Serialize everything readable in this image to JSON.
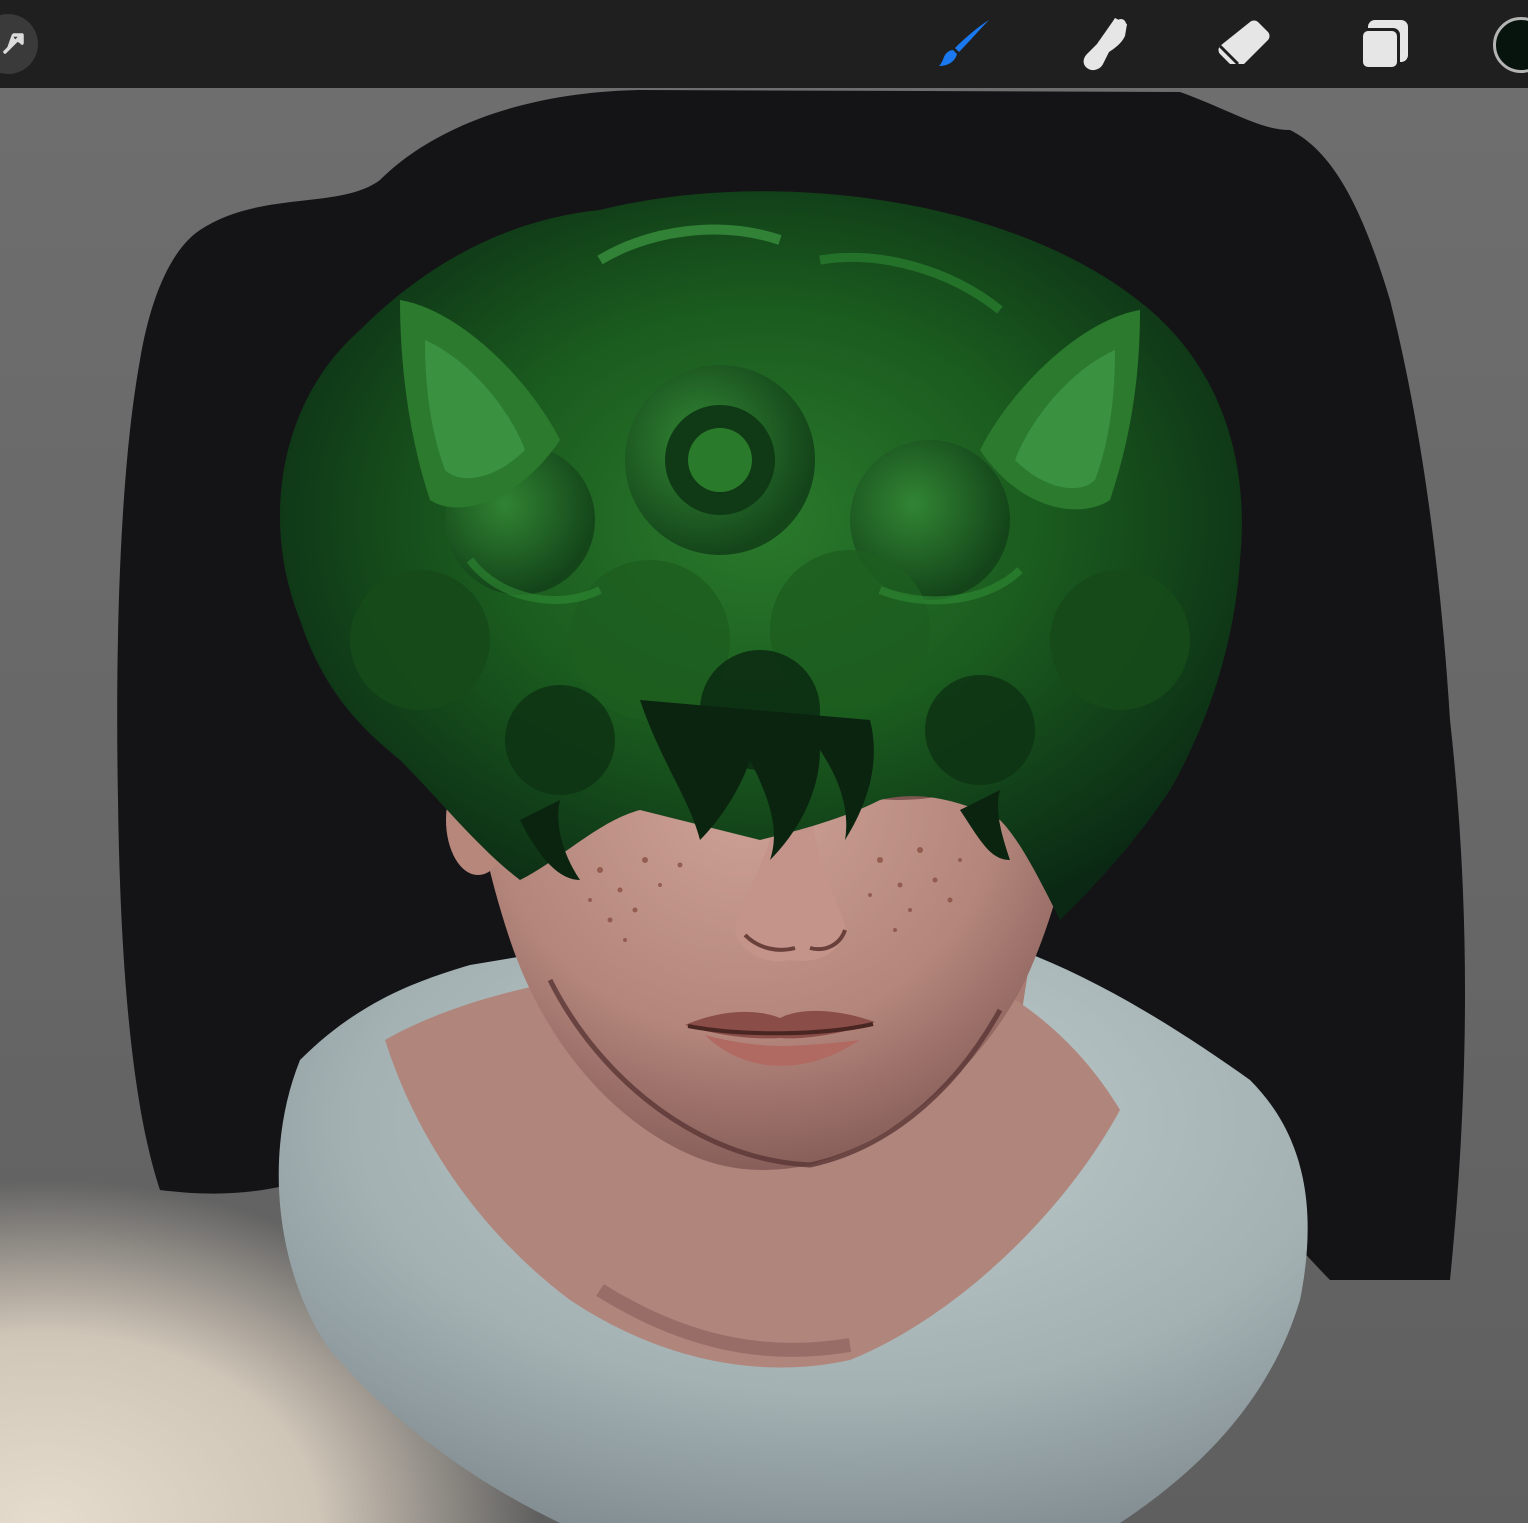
{
  "toolbar": {
    "tools": [
      {
        "id": "transform",
        "icon": "transform-arrow-icon"
      },
      {
        "id": "brush",
        "icon": "brush-icon",
        "active": true
      },
      {
        "id": "smudge",
        "icon": "smudge-icon"
      },
      {
        "id": "eraser",
        "icon": "eraser-icon"
      },
      {
        "id": "layers",
        "icon": "layers-icon"
      }
    ],
    "current_color": "#07140e",
    "active_color": "#1a78f0",
    "icon_color": "#e6e6e6"
  },
  "canvas": {
    "background_color": "#6a6a6a",
    "subject": {
      "hair_color": "#1f5a22",
      "skin_color": "#b98a80",
      "shirt_color": "#a3b1b3",
      "backdrop_color": "#141416"
    }
  }
}
